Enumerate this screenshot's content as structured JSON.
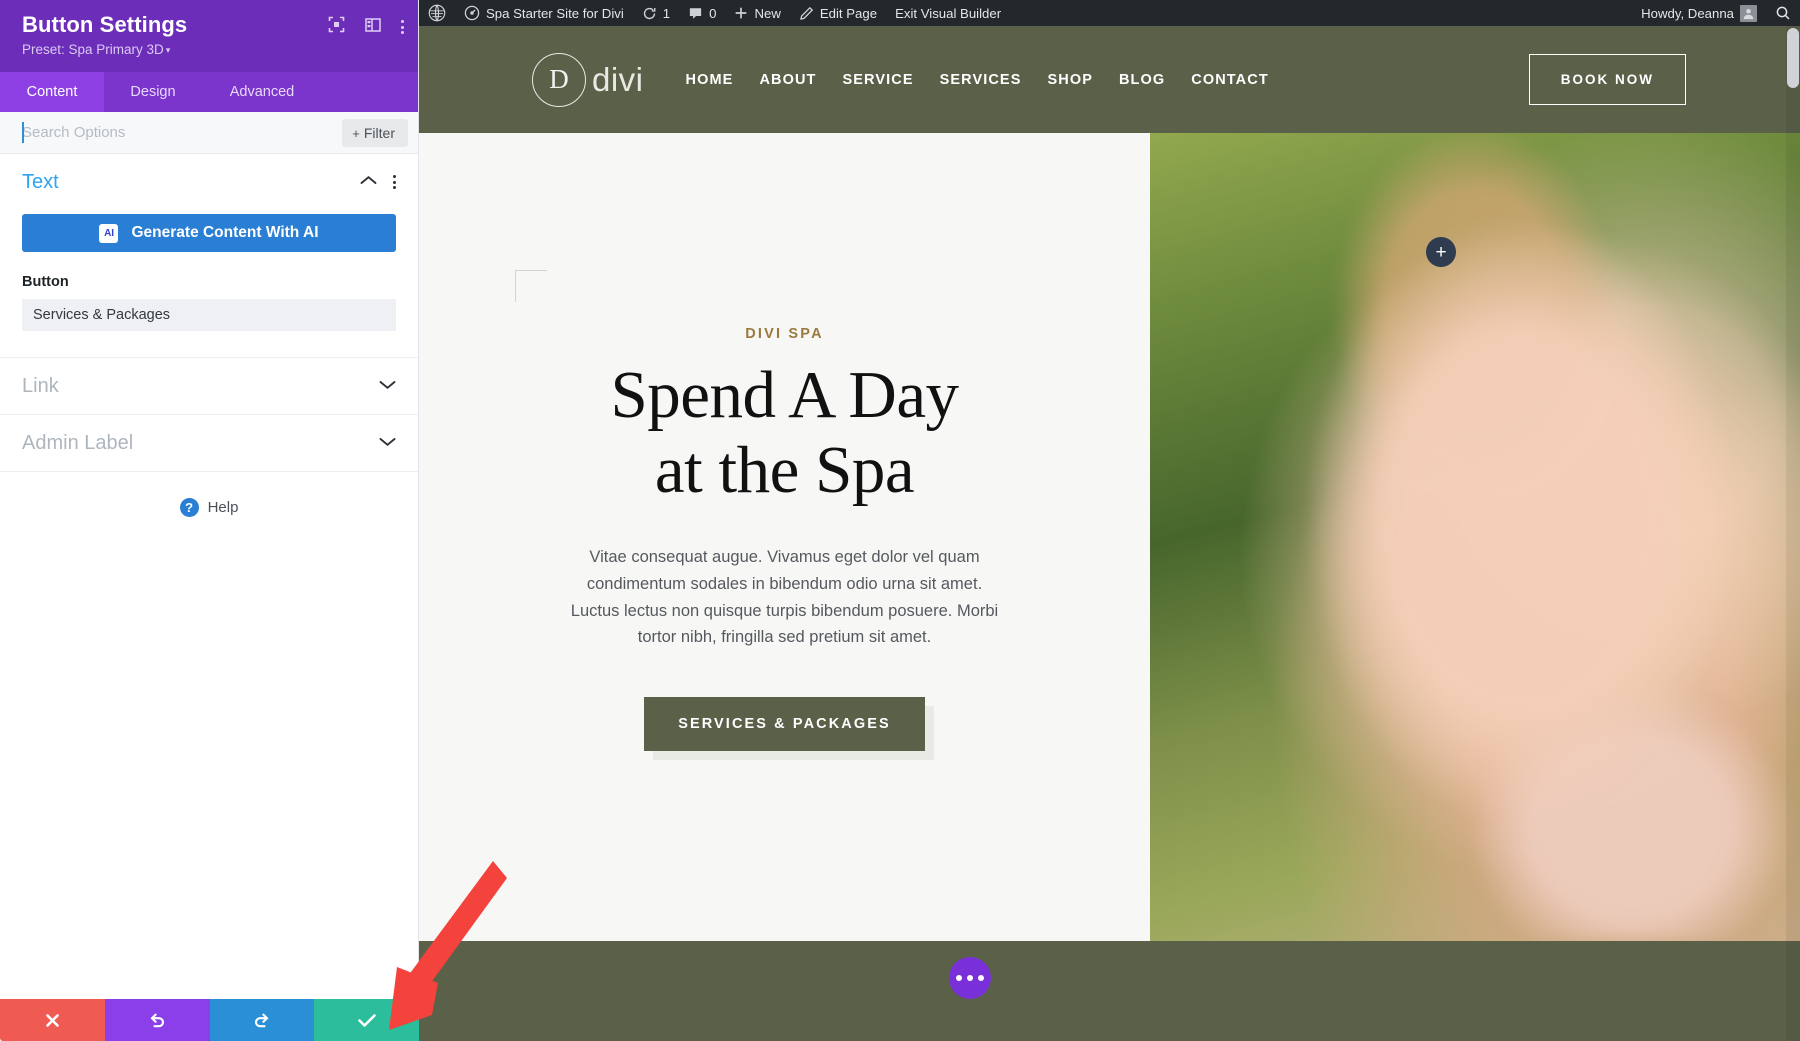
{
  "settings_panel": {
    "title": "Button Settings",
    "preset_label": "Preset: Spa Primary 3D",
    "preset_caret": "▾",
    "header_icons": [
      {
        "name": "focus-target-icon"
      },
      {
        "name": "layout-columns-icon"
      },
      {
        "name": "more-vertical-icon"
      }
    ],
    "tabs": [
      {
        "label": "Content",
        "active": true
      },
      {
        "label": "Design",
        "active": false
      },
      {
        "label": "Advanced",
        "active": false
      }
    ],
    "search": {
      "value": "",
      "placeholder": "Search Options"
    },
    "filter_button": {
      "plus": "+",
      "label": "Filter"
    },
    "sections": [
      {
        "title": "Text",
        "state": "open",
        "ai_button": {
          "badge": "AI",
          "label": "Generate Content With AI"
        },
        "field_label": "Button",
        "field_value": "Services & Packages"
      },
      {
        "title": "Link",
        "state": "closed"
      },
      {
        "title": "Admin Label",
        "state": "closed"
      }
    ],
    "help": {
      "glyph": "?",
      "label": "Help"
    },
    "footer_buttons": [
      {
        "name": "cancel-button",
        "glyph": "✖",
        "color": "#ef5a52"
      },
      {
        "name": "undo-button",
        "glyph": "↺",
        "color": "#8b3fe8"
      },
      {
        "name": "redo-button",
        "glyph": "↻",
        "color": "#2a8fd4"
      },
      {
        "name": "save-button",
        "glyph": "✔",
        "color": "#2bbd9c"
      }
    ]
  },
  "admin_bar": {
    "wp_logo": "Ⓦ",
    "site_name": "Spa Starter Site for Divi",
    "updates_icon": "⟳",
    "updates_count": "1",
    "comments_icon": "🗨",
    "comments_count": "0",
    "new_icon": "+",
    "new_label": "New",
    "edit_icon": "✎",
    "edit_label": "Edit Page",
    "exit_label": "Exit Visual Builder",
    "howdy": "Howdy, Deanna",
    "search_icon": "⌕"
  },
  "site": {
    "logo_letter": "D",
    "logo_word": "divi",
    "nav": [
      "HOME",
      "ABOUT",
      "SERVICE",
      "SERVICES",
      "SHOP",
      "BLOG",
      "CONTACT"
    ],
    "book_button": "BOOK NOW",
    "hero": {
      "eyebrow": "DIVI SPA",
      "title_line1": "Spend A Day",
      "title_line2": "at the Spa",
      "paragraph": "Vitae consequat augue. Vivamus eget dolor vel quam condimentum sodales in bibendum odio urna sit amet. Luctus lectus non quisque turpis bibendum posuere. Morbi tortor nibh, fringilla sed pretium sit amet.",
      "cta_label": "SERVICES & PACKAGES"
    },
    "add_section_glyph": "+"
  },
  "colors": {
    "panel_purple": "#6c2eb9",
    "tab_active": "#8e3fe3",
    "accent_blue": "#2ea3f2",
    "site_olive": "#5b6049",
    "eyebrow_gold": "#9b7a3f",
    "save_green": "#2bbd9c",
    "annotation_red": "#f4423c"
  }
}
